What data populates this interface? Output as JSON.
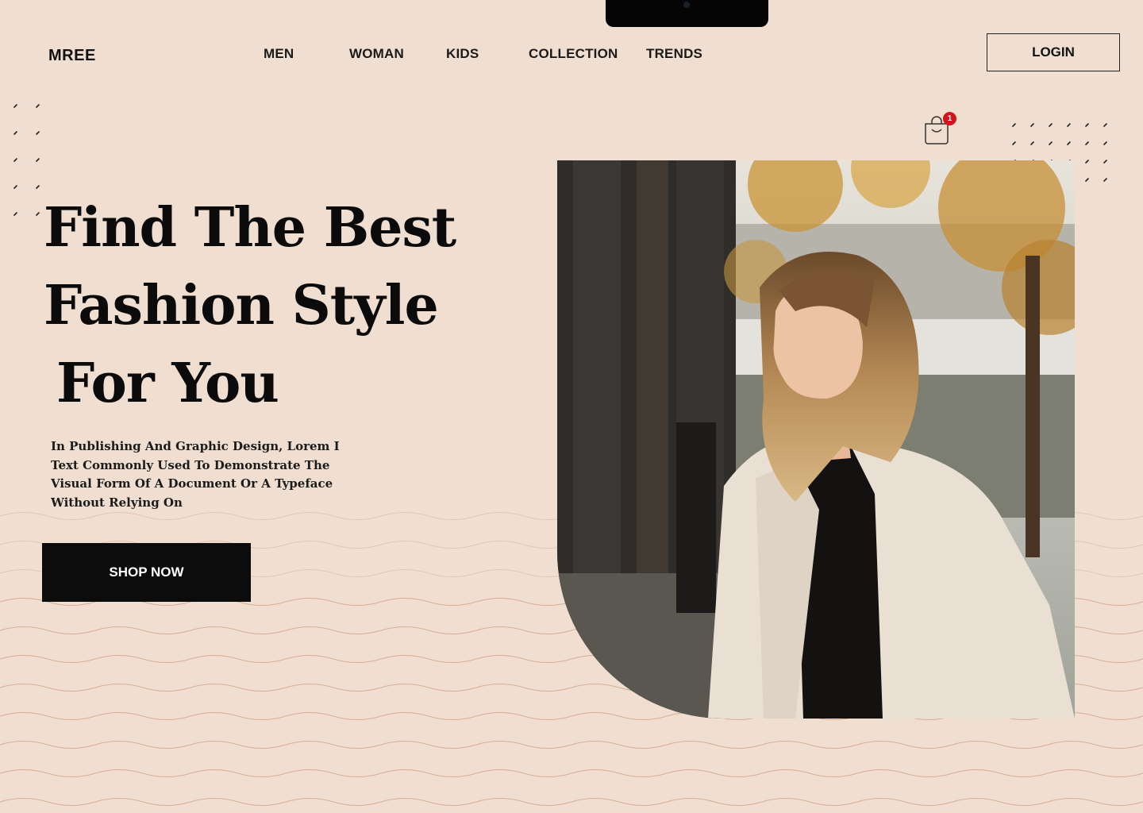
{
  "brand": {
    "name": "MREE"
  },
  "nav": {
    "items": [
      {
        "label": "MEN"
      },
      {
        "label": "WOMAN"
      },
      {
        "label": "KIDS"
      },
      {
        "label": "COLLECTION"
      },
      {
        "label": "TRENDS"
      }
    ]
  },
  "header": {
    "login_label": "LOGIN"
  },
  "cart": {
    "icon": "shopping-bag-icon",
    "count": "1"
  },
  "hero": {
    "headline": [
      "Find The Best",
      "Fashion Style",
      "For You"
    ],
    "description": "In Publishing And Graphic Design, Lorem I Text Commonly Used To Demonstrate The Visual Form Of A Document Or A Typeface Without Relying On",
    "cta_label": "SHOP NOW",
    "image": "woman-in-beige-jacket-photo"
  },
  "colors": {
    "background": "#f0dfd0",
    "text": "#0b0b0b",
    "button": "#0c0c0c",
    "badge": "#d4141c",
    "wave": "#c9987a"
  }
}
